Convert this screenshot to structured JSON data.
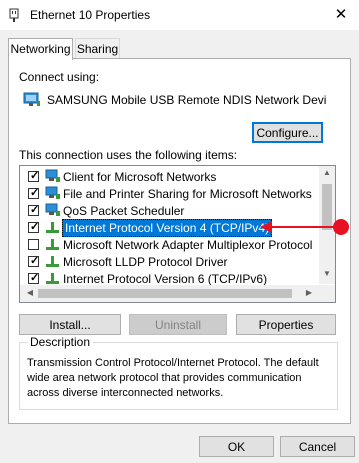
{
  "window": {
    "title": "Ethernet 10 Properties",
    "close_glyph": "✕"
  },
  "tabs": [
    {
      "label": "Networking",
      "active": true
    },
    {
      "label": "Sharing",
      "active": false
    }
  ],
  "connect_using": {
    "label": "Connect using:",
    "device": "SAMSUNG Mobile USB Remote NDIS Network Device #",
    "icon": "network-adapter-icon"
  },
  "buttons": {
    "configure": "Configure...",
    "install": "Install...",
    "uninstall": "Uninstall",
    "properties": "Properties",
    "ok": "OK",
    "cancel": "Cancel"
  },
  "items_label": "This connection uses the following items:",
  "items": [
    {
      "label": "Client for Microsoft Networks",
      "checked": true,
      "icon": "network-client-icon"
    },
    {
      "label": "File and Printer Sharing for Microsoft Networks",
      "checked": true,
      "icon": "network-client-icon"
    },
    {
      "label": "QoS Packet Scheduler",
      "checked": true,
      "icon": "network-client-icon"
    },
    {
      "label": "Internet Protocol Version 4 (TCP/IPv4)",
      "checked": true,
      "icon": "protocol-icon",
      "selected": true
    },
    {
      "label": "Microsoft Network Adapter Multiplexor Protocol",
      "checked": false,
      "icon": "protocol-icon"
    },
    {
      "label": "Microsoft LLDP Protocol Driver",
      "checked": true,
      "icon": "protocol-icon"
    },
    {
      "label": "Internet Protocol Version 6 (TCP/IPv6)",
      "checked": true,
      "icon": "protocol-icon"
    }
  ],
  "description": {
    "title": "Description",
    "text": "Transmission Control Protocol/Internet Protocol. The default wide area network protocol that provides communication across diverse interconnected networks."
  },
  "colors": {
    "selection": "#0078d7",
    "annotation": "#e81123"
  }
}
